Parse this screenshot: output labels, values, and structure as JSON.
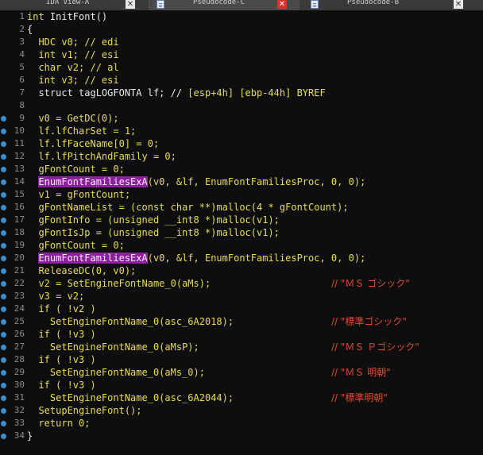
{
  "tabs": [
    {
      "label": "IDA View-A",
      "active": false
    },
    {
      "label": "Pseudocode-C",
      "active": true
    },
    {
      "label": "Pseudocode-B",
      "active": false
    }
  ],
  "lines": [
    {
      "n": "1",
      "bp": false,
      "parts": [
        {
          "t": "int",
          "c": "kw"
        },
        {
          "t": " InitFont()",
          "c": "plain"
        }
      ]
    },
    {
      "n": "2",
      "bp": false,
      "parts": [
        {
          "t": "{",
          "c": "plain"
        }
      ]
    },
    {
      "n": "3",
      "bp": false,
      "parts": [
        {
          "t": "  HDC v0; // edi",
          "c": "kw"
        }
      ]
    },
    {
      "n": "4",
      "bp": false,
      "parts": [
        {
          "t": "  int v1; // esi",
          "c": "kw"
        }
      ]
    },
    {
      "n": "5",
      "bp": false,
      "parts": [
        {
          "t": "  char v2; // al",
          "c": "kw"
        }
      ]
    },
    {
      "n": "6",
      "bp": false,
      "parts": [
        {
          "t": "  int",
          "c": "kw"
        },
        {
          "t": " v3; // esi",
          "c": "kw"
        }
      ]
    },
    {
      "n": "7",
      "bp": false,
      "parts": [
        {
          "t": "  struct tagLOGFONTA lf; // ",
          "c": "plain"
        },
        {
          "t": "[esp+4h] [ebp-44h] BYREF",
          "c": "kw"
        }
      ]
    },
    {
      "n": "8",
      "bp": false,
      "parts": []
    },
    {
      "n": "9",
      "bp": true,
      "parts": [
        {
          "t": "  v0 = GetDC(0);",
          "c": "kw"
        }
      ]
    },
    {
      "n": "10",
      "bp": true,
      "parts": [
        {
          "t": "  lf.lfCharSet = 1;",
          "c": "kw"
        }
      ]
    },
    {
      "n": "11",
      "bp": true,
      "parts": [
        {
          "t": "  lf.lfFaceName[0] = 0;",
          "c": "kw"
        }
      ]
    },
    {
      "n": "12",
      "bp": true,
      "parts": [
        {
          "t": "  lf.lfPitchAndFamily = 0;",
          "c": "kw"
        }
      ]
    },
    {
      "n": "13",
      "bp": true,
      "parts": [
        {
          "t": "  gFontCount = 0;",
          "c": "kw"
        }
      ]
    },
    {
      "n": "14",
      "bp": true,
      "parts": [
        {
          "t": "  ",
          "c": "plain"
        },
        {
          "t": "EnumFontFamiliesExA",
          "c": "hl"
        },
        {
          "t": "(v0, &lf, EnumFontFamiliesProc, 0, 0);",
          "c": "kw"
        }
      ]
    },
    {
      "n": "15",
      "bp": true,
      "parts": [
        {
          "t": "  v1 = gFontCount;",
          "c": "kw"
        }
      ]
    },
    {
      "n": "16",
      "bp": true,
      "parts": [
        {
          "t": "  gFontNameList = (",
          "c": "kw"
        },
        {
          "t": "const char **",
          "c": "kw"
        },
        {
          "t": ")malloc(4 * gFontCount);",
          "c": "kw"
        }
      ]
    },
    {
      "n": "17",
      "bp": true,
      "parts": [
        {
          "t": "  gFontInfo = (",
          "c": "kw"
        },
        {
          "t": "unsigned __int8 *",
          "c": "kw"
        },
        {
          "t": ")malloc(v1);",
          "c": "kw"
        }
      ]
    },
    {
      "n": "18",
      "bp": true,
      "parts": [
        {
          "t": "  gFontIsJp = (",
          "c": "kw"
        },
        {
          "t": "unsigned __int8 *",
          "c": "kw"
        },
        {
          "t": ")malloc(v1);",
          "c": "kw"
        }
      ]
    },
    {
      "n": "19",
      "bp": true,
      "parts": [
        {
          "t": "  gFontCount = 0;",
          "c": "kw"
        }
      ]
    },
    {
      "n": "20",
      "bp": true,
      "parts": [
        {
          "t": "  ",
          "c": "plain"
        },
        {
          "t": "EnumFontFamiliesExA",
          "c": "hl"
        },
        {
          "t": "(v0, &lf, EnumFontFamiliesProc, 0, 0);",
          "c": "kw"
        }
      ]
    },
    {
      "n": "21",
      "bp": true,
      "parts": [
        {
          "t": "  ReleaseDC(0, v0);",
          "c": "kw"
        }
      ]
    },
    {
      "n": "22",
      "bp": true,
      "parts": [
        {
          "t": "  v2 = SetEngineFontName_0(aMs);",
          "c": "kw"
        }
      ],
      "comment": "// \"ＭＳ ゴシック\""
    },
    {
      "n": "23",
      "bp": true,
      "parts": [
        {
          "t": "  v3 = v2;",
          "c": "kw"
        }
      ]
    },
    {
      "n": "24",
      "bp": true,
      "parts": [
        {
          "t": "  if ( !v2 )",
          "c": "kw"
        }
      ]
    },
    {
      "n": "25",
      "bp": true,
      "parts": [
        {
          "t": "    SetEngineFontName_0(asc_6A2018);",
          "c": "kw"
        }
      ],
      "comment": "// \"標準ゴシック\""
    },
    {
      "n": "26",
      "bp": true,
      "parts": [
        {
          "t": "  if ( !v3 )",
          "c": "kw"
        }
      ]
    },
    {
      "n": "27",
      "bp": true,
      "parts": [
        {
          "t": "    SetEngineFontName_0(aMsP);",
          "c": "kw"
        }
      ],
      "comment": "// \"ＭＳ Ｐゴシック\""
    },
    {
      "n": "28",
      "bp": true,
      "parts": [
        {
          "t": "  if ( !v3 )",
          "c": "kw"
        }
      ]
    },
    {
      "n": "29",
      "bp": true,
      "parts": [
        {
          "t": "    SetEngineFontName_0(aMs_0);",
          "c": "kw"
        }
      ],
      "comment": "// \"ＭＳ 明朝\""
    },
    {
      "n": "30",
      "bp": true,
      "parts": [
        {
          "t": "  if ( !v3 )",
          "c": "kw"
        }
      ]
    },
    {
      "n": "31",
      "bp": true,
      "parts": [
        {
          "t": "    SetEngineFontName_0(asc_6A2044);",
          "c": "kw"
        }
      ],
      "comment": "// \"標準明朝\""
    },
    {
      "n": "32",
      "bp": true,
      "parts": [
        {
          "t": "  SetupEngineFont();",
          "c": "kw"
        }
      ]
    },
    {
      "n": "33",
      "bp": true,
      "parts": [
        {
          "t": "  return 0;",
          "c": "kw"
        }
      ]
    },
    {
      "n": "34",
      "bp": true,
      "parts": [
        {
          "t": "}",
          "c": "plain"
        }
      ]
    }
  ]
}
